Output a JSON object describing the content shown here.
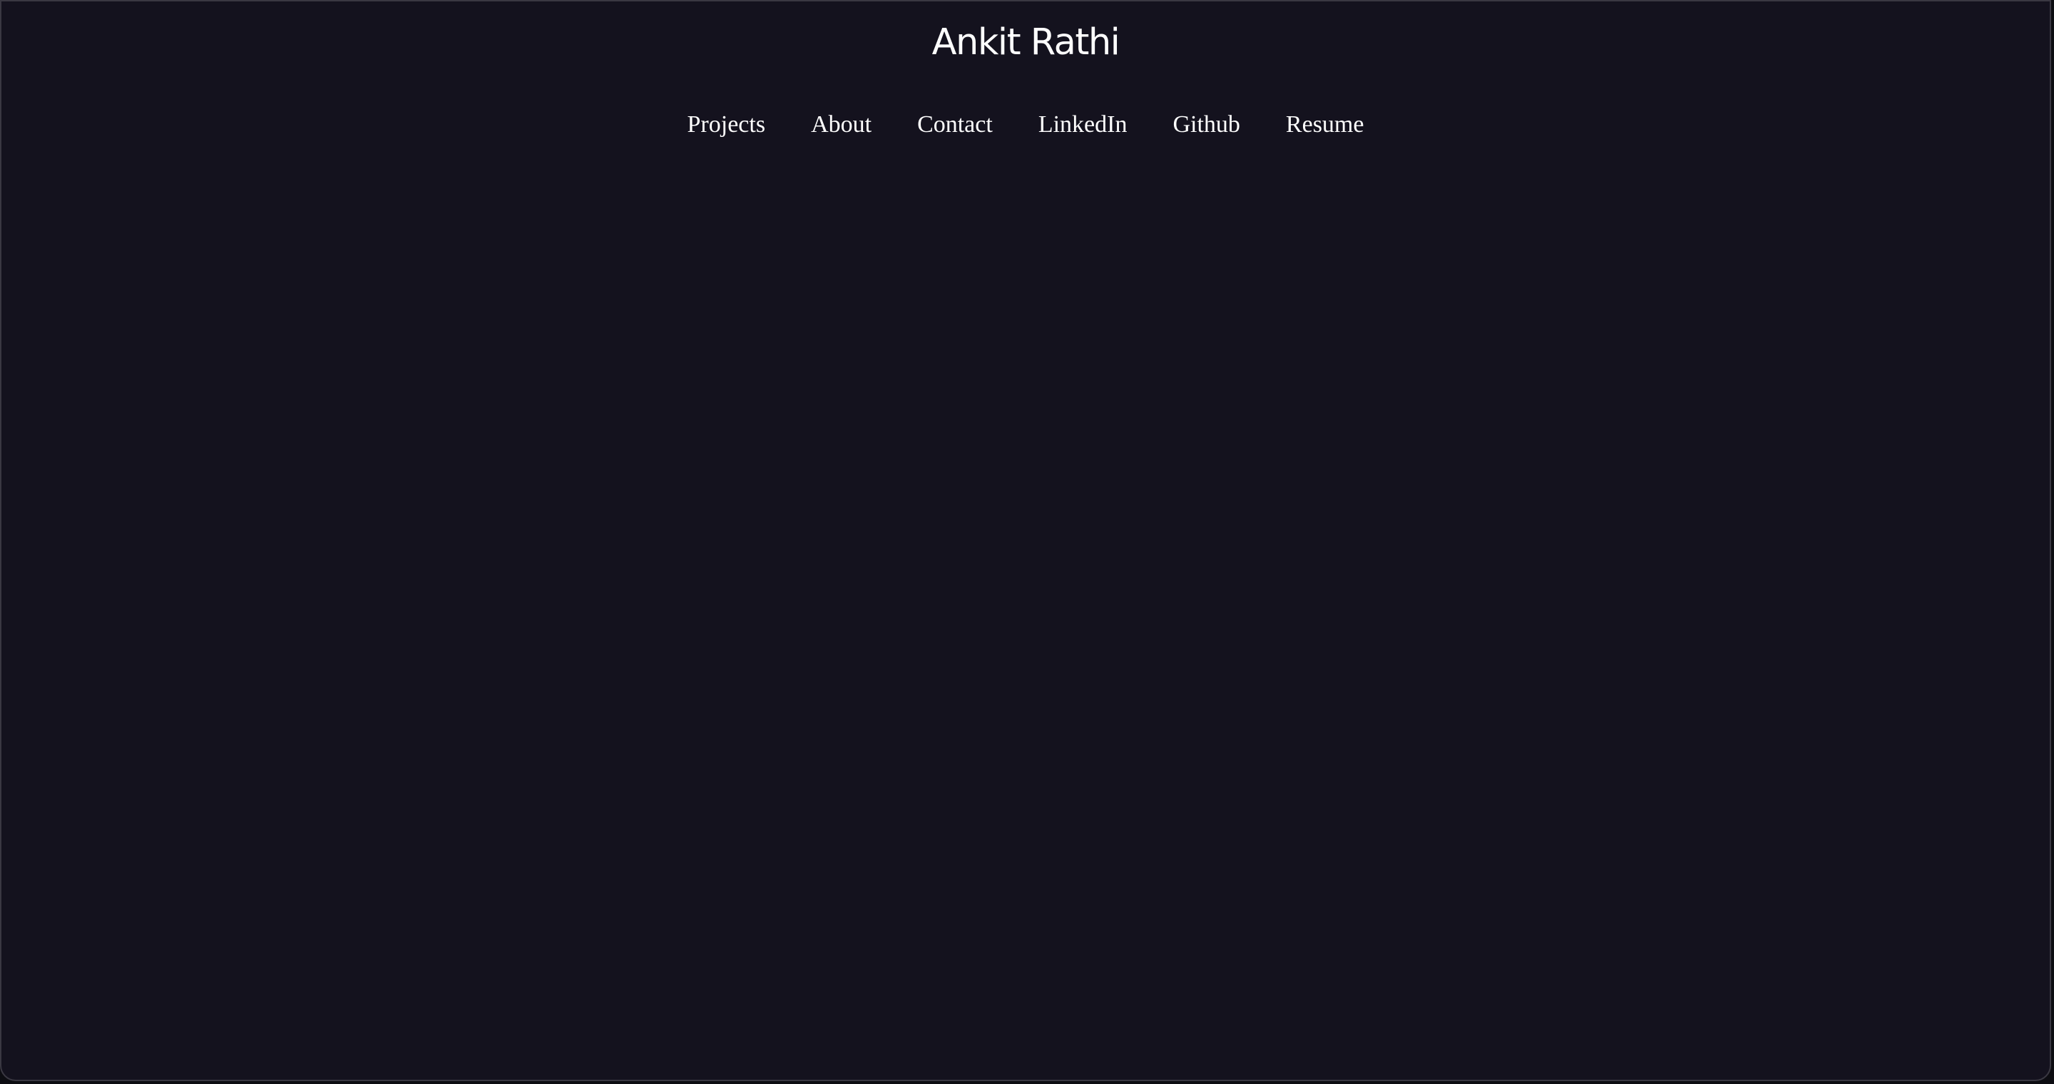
{
  "header": {
    "title": "Ankit Rathi"
  },
  "nav": {
    "items": [
      {
        "label": "Projects"
      },
      {
        "label": "About"
      },
      {
        "label": "Contact"
      },
      {
        "label": "LinkedIn"
      },
      {
        "label": "Github"
      },
      {
        "label": "Resume"
      }
    ]
  },
  "colors": {
    "background": "#14121e",
    "text": "#ffffff"
  }
}
